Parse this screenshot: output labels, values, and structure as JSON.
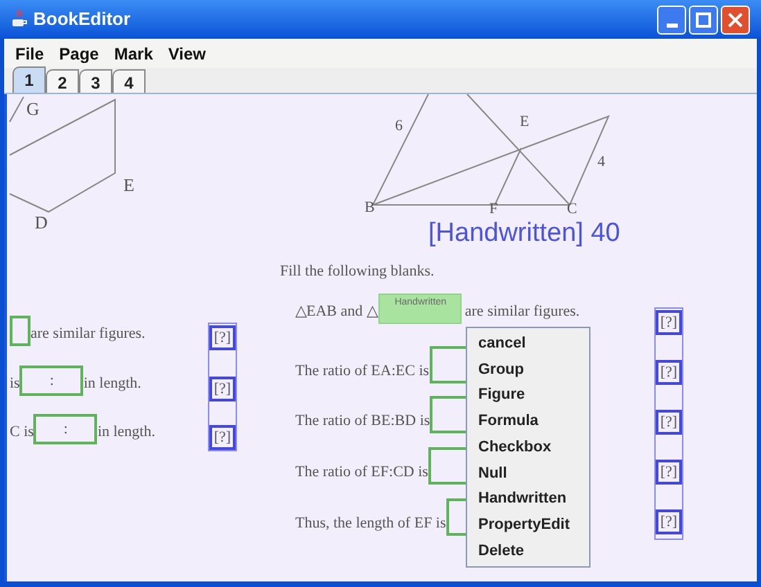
{
  "window": {
    "title": "BookEditor"
  },
  "menu_bar": [
    "File",
    "Page",
    "Mark",
    "View"
  ],
  "tabs": [
    {
      "label": "1",
      "selected": true
    },
    {
      "label": "2",
      "selected": false
    },
    {
      "label": "3",
      "selected": false
    },
    {
      "label": "4",
      "selected": false
    }
  ],
  "left_page": {
    "figure_labels": [
      "G",
      "E",
      "D"
    ],
    "rows": [
      {
        "prefix": "",
        "separator": "",
        "suffix": "are similar figures."
      },
      {
        "prefix": "is",
        "separator": ":",
        "suffix": "in length."
      },
      {
        "prefix": "C is",
        "separator": ":",
        "suffix": "in length."
      }
    ],
    "markers": [
      "[?]",
      "[?]",
      "[?]"
    ]
  },
  "right_page": {
    "figure_labels": [
      "6",
      "E",
      "4",
      "B",
      "F",
      "C"
    ],
    "annotation": "[Handwritten] 40",
    "instruction": "Fill the following blanks.",
    "rows": [
      {
        "prefix": "△EAB and △",
        "blank_label": "Handwritten",
        "highlighted": true,
        "suffix": "are similar figures."
      },
      {
        "prefix": "The ratio of EA:EC is",
        "highlighted": false
      },
      {
        "prefix": "The ratio of BE:BD is",
        "highlighted": false
      },
      {
        "prefix": "The ratio of EF:CD is",
        "highlighted": false
      },
      {
        "prefix": "Thus, the length of EF is",
        "highlighted": false
      }
    ],
    "markers": [
      "[?]",
      "[?]",
      "[?]",
      "[?]",
      "[?]"
    ]
  },
  "context_menu": [
    "cancel",
    "Group",
    "Figure",
    "Formula",
    "Checkbox",
    "Null",
    "Handwritten",
    "PropertyEdit",
    "Delete"
  ]
}
